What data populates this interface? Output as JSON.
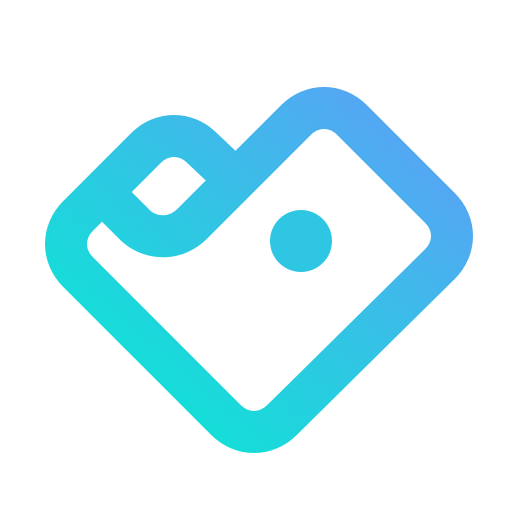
{
  "logo": {
    "icon": "heart-wallet-logo-icon",
    "colors": {
      "gradient_start": "#0BE6D4",
      "gradient_end": "#55A6F3",
      "dot": "#2EC6E3",
      "background": "#FFFFFF"
    }
  }
}
